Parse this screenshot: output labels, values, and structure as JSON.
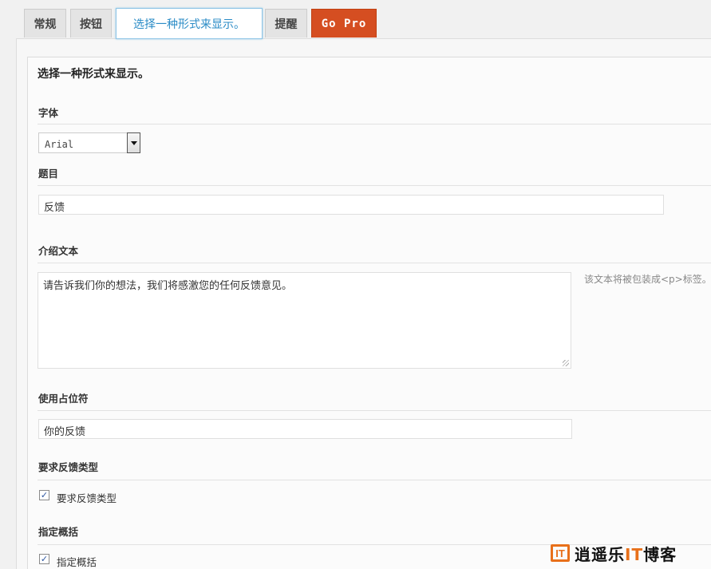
{
  "tabs": [
    {
      "label": "常规"
    },
    {
      "label": "按钮"
    },
    {
      "label": "选择一种形式来显示。"
    },
    {
      "label": "提醒"
    },
    {
      "label": "Go Pro"
    }
  ],
  "panel": {
    "title": "选择一种形式来显示。",
    "font": {
      "label": "字体",
      "value": "Arial"
    },
    "subject": {
      "label": "题目",
      "value": "反馈"
    },
    "intro": {
      "label": "介绍文本",
      "value": "请告诉我们你的想法，我们将感激您的任何反馈意见。",
      "hint": "该文本将被包装成<p>标签。"
    },
    "placeholder": {
      "label": "使用占位符",
      "value": "你的反馈"
    },
    "require_type": {
      "heading": "要求反馈类型",
      "checkbox_label": "要求反馈类型",
      "checked": true
    },
    "summary": {
      "heading": "指定概括",
      "checkbox_label": "指定概括",
      "checked": true
    }
  },
  "watermark": {
    "logo": "IT",
    "text_a": "逍遥乐",
    "text_it": "IT",
    "text_b": "博客"
  },
  "colors": {
    "accent": "#2a8bc6",
    "pro": "#d54e21",
    "watermark": "#e8701a"
  }
}
